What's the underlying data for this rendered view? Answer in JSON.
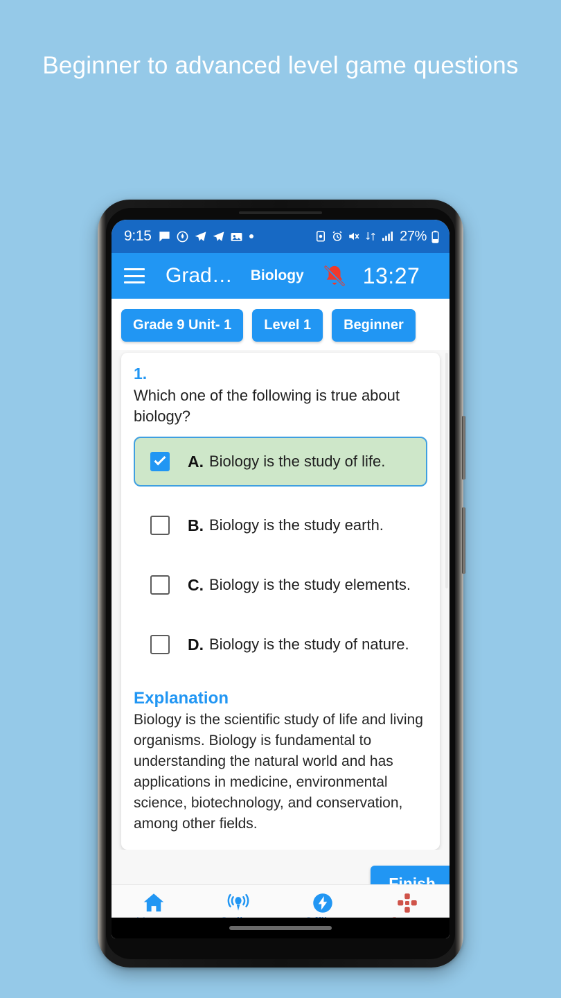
{
  "promo": {
    "headline": "Beginner to advanced level game questions"
  },
  "colors": {
    "page_background": "#95c9e8",
    "status_bar": "#1769c4",
    "app_bar": "#2196f3",
    "accent_blue": "#2196f3",
    "selected_option_bg": "#cee7c9",
    "selected_option_border": "#3f9fe0",
    "active_nav": "#cf5349",
    "inactive_nav": "#4a90d9"
  },
  "status_bar": {
    "clock": "9:15",
    "battery_percent": "27%",
    "left_icons": [
      "message-icon",
      "location-pin-icon",
      "telegram-icon",
      "telegram-icon",
      "photo-app-icon",
      "dot-icon"
    ],
    "right_icons": [
      "screen-record-icon",
      "alarm-icon",
      "volume-mute-icon",
      "data-transfer-icon",
      "signal-bars-icon",
      "battery-icon"
    ]
  },
  "app_bar": {
    "menu_icon": "hamburger-menu-icon",
    "title": "Grad…",
    "subject": "Biology",
    "bell_icon": "bell-off-icon",
    "timer": "13:27"
  },
  "chips": [
    {
      "label": "Grade 9 Unit- 1"
    },
    {
      "label": "Level 1"
    },
    {
      "label": "Beginner"
    }
  ],
  "question": {
    "number": "1.",
    "text": "Which one of the following is true about biology?",
    "options": [
      {
        "letter": "A.",
        "text": "Biology is the study of life.",
        "selected": true
      },
      {
        "letter": "B.",
        "text": "Biology is the study earth.",
        "selected": false
      },
      {
        "letter": "C.",
        "text": "Biology is the study elements.",
        "selected": false
      },
      {
        "letter": "D.",
        "text": "Biology is the study of nature.",
        "selected": false
      }
    ],
    "explanation_title": "Explanation",
    "explanation_body": "Biology is the scientific study of life and living organisms. Biology is fundamental to understanding the natural world and has applications in medicine, environmental science, biotechnology, and conservation, among other fields."
  },
  "actions": {
    "finish_label": "Finish"
  },
  "bottom_nav": [
    {
      "label": "Home",
      "icon": "home-icon",
      "active": false
    },
    {
      "label": "Online",
      "icon": "broadcast-icon",
      "active": false
    },
    {
      "label": "Offline",
      "icon": "bolt-icon",
      "active": false
    },
    {
      "label": "Game",
      "icon": "dpad-icon",
      "active": true
    }
  ]
}
